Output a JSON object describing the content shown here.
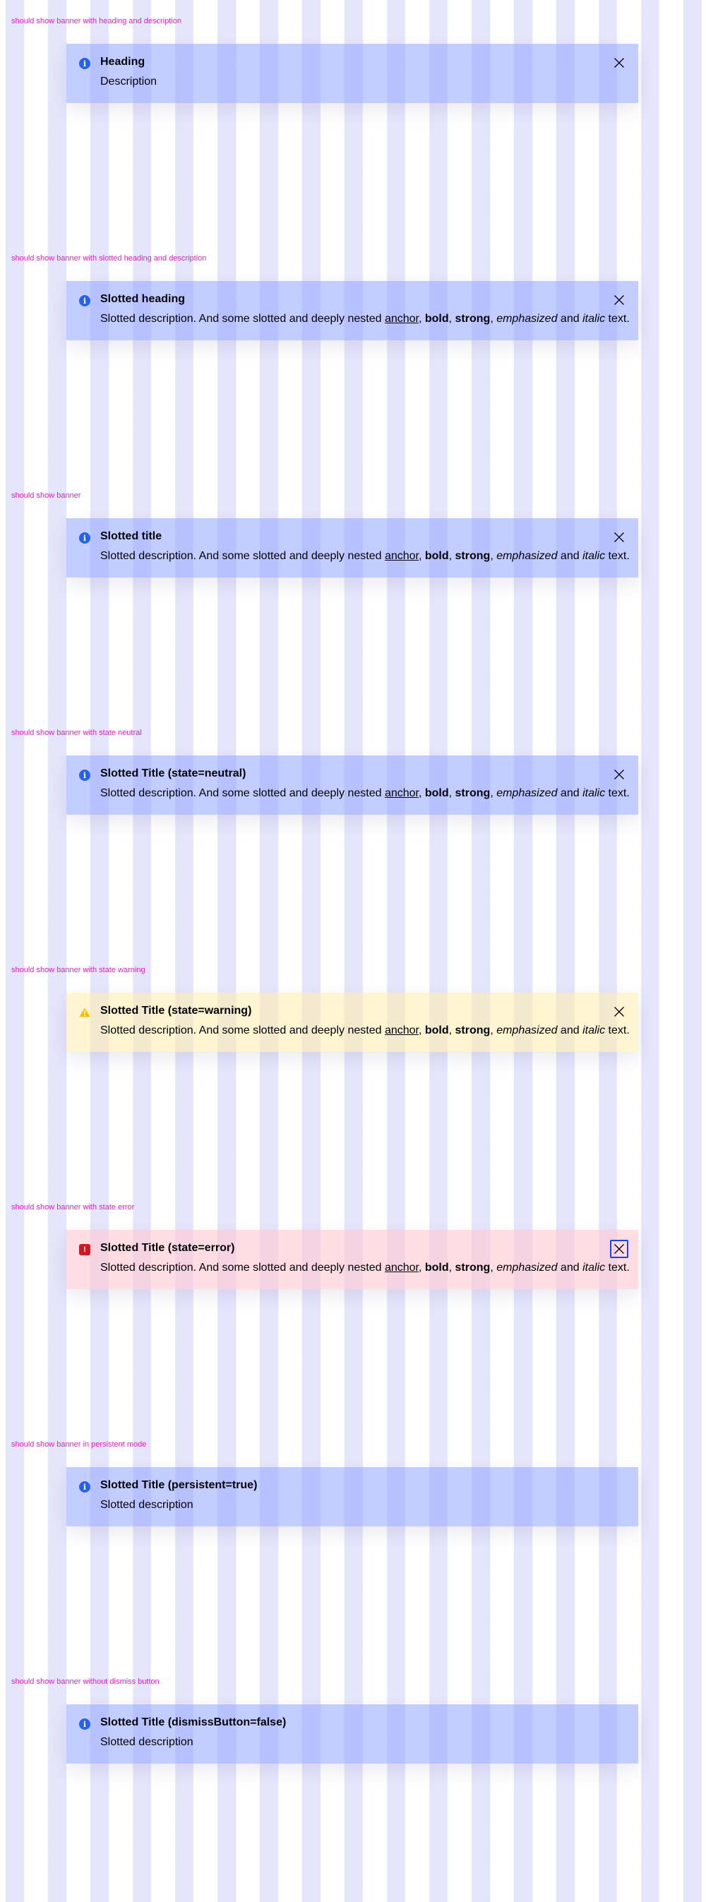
{
  "tests": [
    {
      "label": "should show banner with heading and description",
      "state": "info",
      "heading": "Heading",
      "description": {
        "plain": "Description"
      },
      "dismissable": true,
      "close_focused": false
    },
    {
      "label": "should show banner with slotted heading and description",
      "state": "info",
      "heading": "Slotted heading",
      "description": {
        "pre": "Slotted description. And some slotted and deeply nested ",
        "anchor": "anchor",
        "sep1": ", ",
        "bold": "bold",
        "sep2": ", ",
        "strong": "strong",
        "sep3": ", ",
        "emphasized": "emphasized",
        "and": " and ",
        "italic": "italic",
        "post": " text."
      },
      "dismissable": true,
      "close_focused": false
    },
    {
      "label": "should show banner",
      "state": "info",
      "heading": "Slotted title",
      "description": {
        "pre": "Slotted description. And some slotted and deeply nested ",
        "anchor": "anchor",
        "sep1": ", ",
        "bold": "bold",
        "sep2": ", ",
        "strong": "strong",
        "sep3": ", ",
        "emphasized": "emphasized",
        "and": " and ",
        "italic": "italic",
        "post": " text."
      },
      "dismissable": true,
      "close_focused": false
    },
    {
      "label": "should show banner with state neutral",
      "state": "info",
      "heading": "Slotted Title (state=neutral)",
      "description": {
        "pre": "Slotted description. And some slotted and deeply nested ",
        "anchor": "anchor",
        "sep1": ", ",
        "bold": "bold",
        "sep2": ", ",
        "strong": "strong",
        "sep3": ", ",
        "emphasized": "emphasized",
        "and": " and ",
        "italic": "italic",
        "post": " text."
      },
      "dismissable": true,
      "close_focused": false
    },
    {
      "label": "should show banner with state warning",
      "state": "warning",
      "heading": "Slotted Title (state=warning)",
      "description": {
        "pre": "Slotted description. And some slotted and deeply nested ",
        "anchor": "anchor",
        "sep1": ", ",
        "bold": "bold",
        "sep2": ", ",
        "strong": "strong",
        "sep3": ", ",
        "emphasized": "emphasized",
        "and": " and ",
        "italic": "italic",
        "post": " text."
      },
      "dismissable": true,
      "close_focused": false
    },
    {
      "label": "should show banner with state error",
      "state": "error",
      "heading": "Slotted Title (state=error)",
      "description": {
        "pre": "Slotted description. And some slotted and deeply nested ",
        "anchor": "anchor",
        "sep1": ", ",
        "bold": "bold",
        "sep2": ", ",
        "strong": "strong",
        "sep3": ", ",
        "emphasized": "emphasized",
        "and": " and ",
        "italic": "italic",
        "post": " text."
      },
      "dismissable": true,
      "close_focused": true
    },
    {
      "label": "should show banner in persistent mode",
      "state": "info",
      "heading": "Slotted Title (persistent=true)",
      "description": {
        "plain": "Slotted description"
      },
      "dismissable": false,
      "close_focused": false
    },
    {
      "label": "should show banner without dismiss button",
      "state": "info",
      "heading": "Slotted Title (dismissButton=false)",
      "description": {
        "plain": "Slotted description"
      },
      "dismissable": false,
      "close_focused": false
    }
  ],
  "icons": {
    "info": "information-icon",
    "warning": "warning-icon",
    "error": "error-icon",
    "close": "close-icon"
  },
  "colors": {
    "label": "#de1fbd",
    "info_accent": "#2762ec",
    "warning_accent": "#f3be00",
    "error_accent": "#cc1922",
    "focus_ring": "#1a44ea"
  }
}
